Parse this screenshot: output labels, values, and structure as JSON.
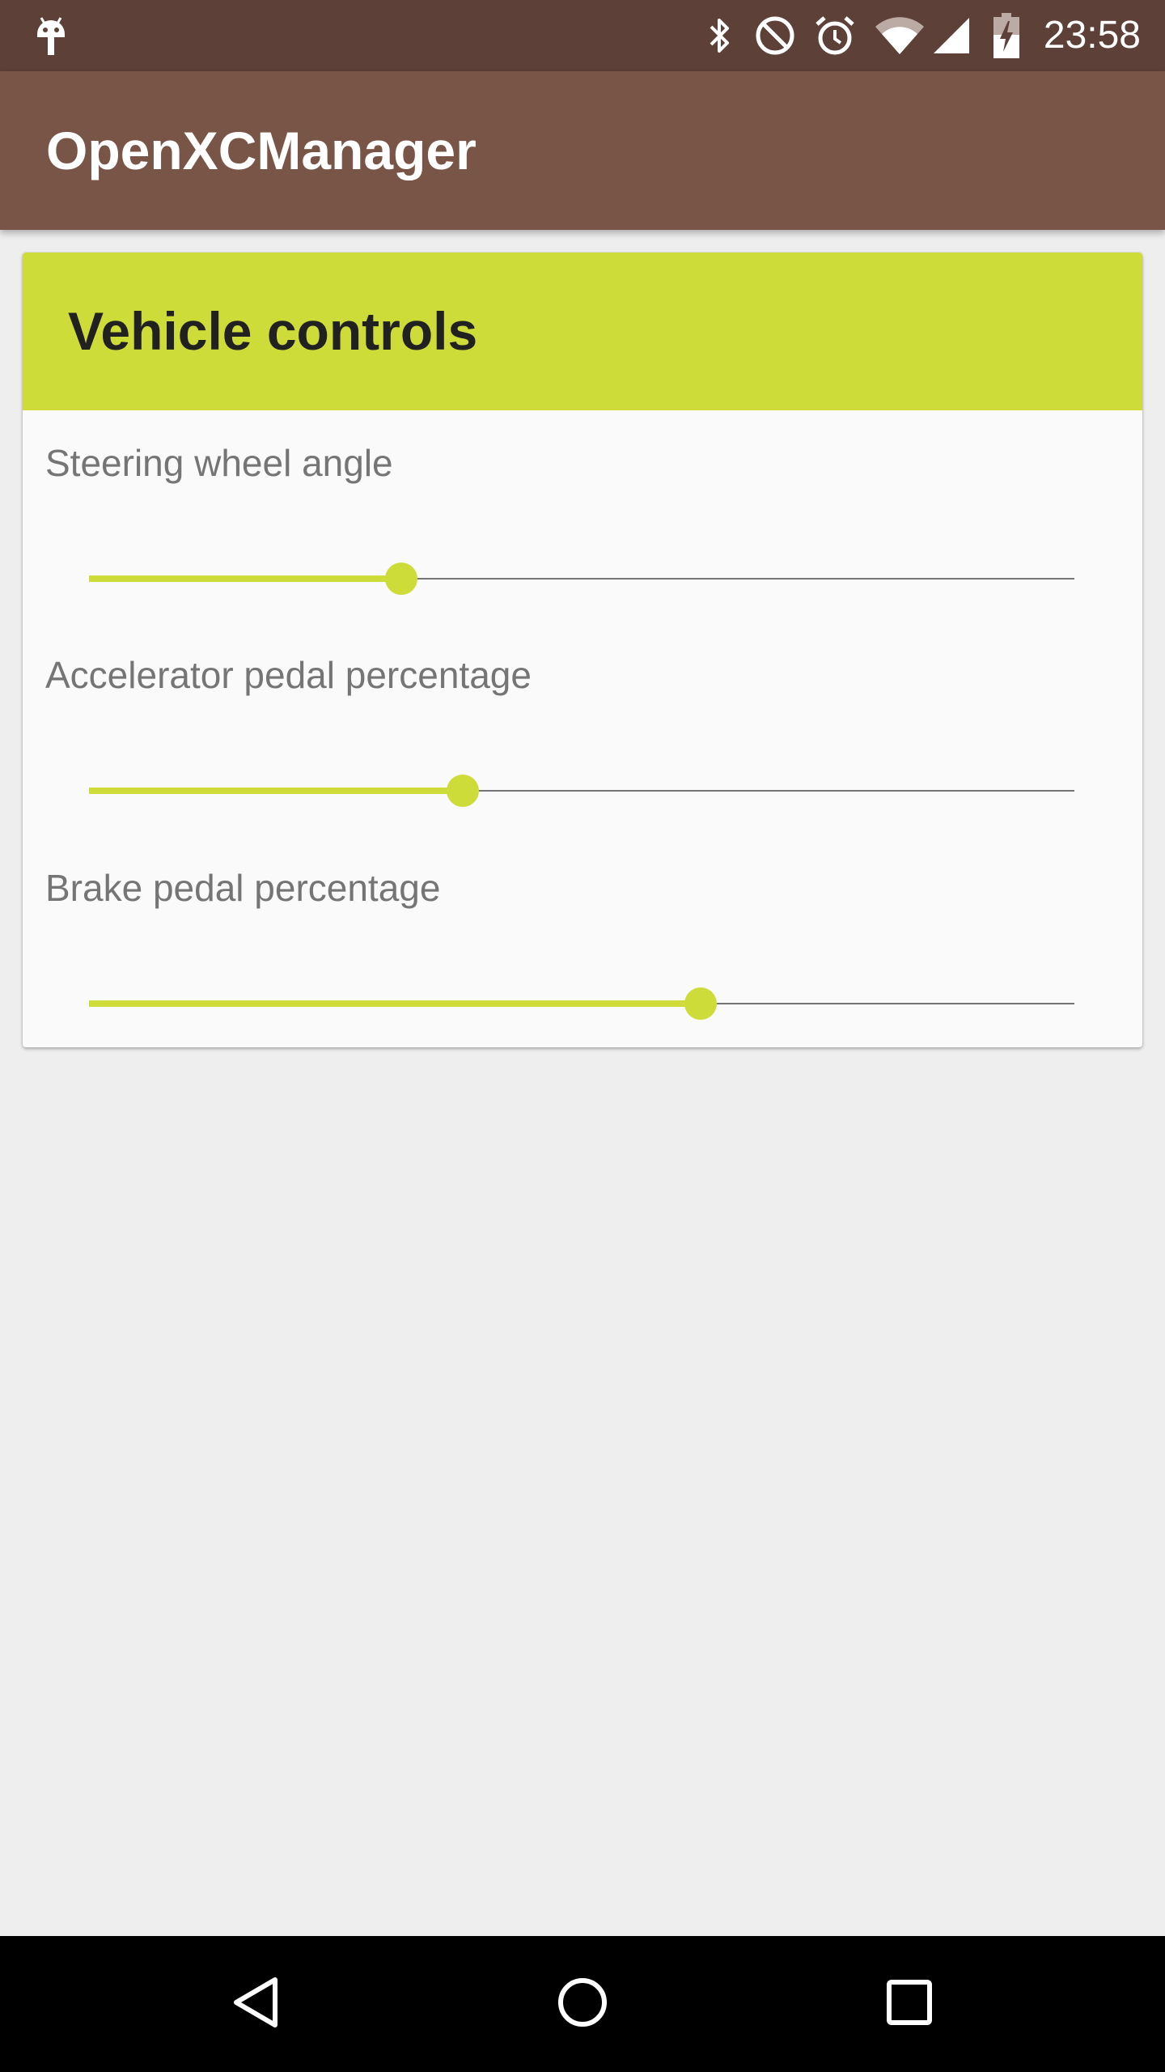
{
  "status_bar": {
    "time": "23:58",
    "icons": [
      "android-debug-icon",
      "bluetooth-icon",
      "do-not-disturb-icon",
      "alarm-icon",
      "wifi-icon",
      "cellular-signal-icon",
      "battery-charging-icon"
    ]
  },
  "app_bar": {
    "title": "OpenXCManager"
  },
  "card": {
    "title": "Vehicle controls",
    "controls": [
      {
        "label": "Steering wheel angle",
        "value_fraction": 0.317
      },
      {
        "label": "Accelerator pedal percentage",
        "value_fraction": 0.379
      },
      {
        "label": "Brake pedal percentage",
        "value_fraction": 0.621
      }
    ]
  },
  "colors": {
    "status_bar": "#5d4037",
    "app_bar": "#795548",
    "accent": "#cddc39",
    "background": "#eeeeee",
    "card_background": "#fafafa",
    "label_text": "#757575",
    "title_text": "#212121",
    "nav_bar": "#000000"
  },
  "nav_bar": {
    "icons": [
      "back-icon",
      "home-icon",
      "recents-icon"
    ]
  }
}
